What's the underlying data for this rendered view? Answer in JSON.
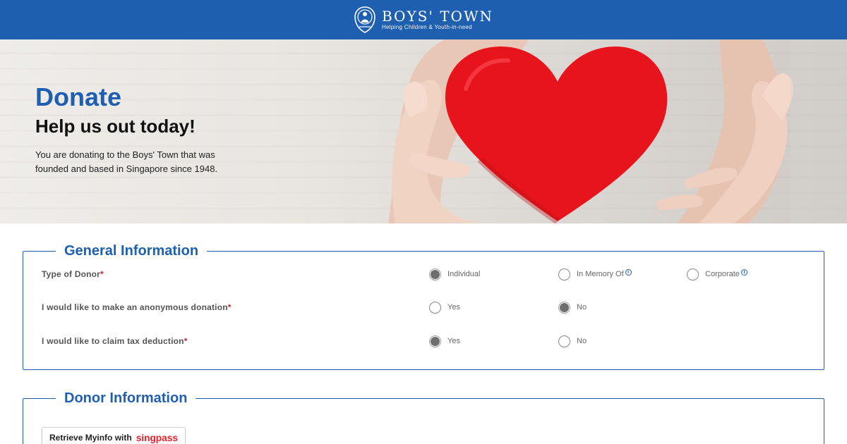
{
  "header": {
    "brand_name": "BOYS' TOWN",
    "brand_tagline": "Helping Children & Youth-in-need",
    "bg_color": "#1f5fb0"
  },
  "hero": {
    "title": "Donate",
    "subtitle": "Help us out today!",
    "description": "You are donating to the Boys' Town that was founded and based in Singapore since 1948.",
    "image_subject": "hands-holding-red-knitted-heart"
  },
  "general_information": {
    "legend": "General Information",
    "questions": [
      {
        "label": "Type of Donor",
        "required_mark": "*",
        "options": [
          {
            "label": "Individual",
            "checked": true,
            "info_icon": false
          },
          {
            "label": "In Memory Of",
            "checked": false,
            "info_icon": true
          },
          {
            "label": "Corporate",
            "checked": false,
            "info_icon": true
          }
        ]
      },
      {
        "label": "I would like to make an anonymous donation",
        "required_mark": "*",
        "options": [
          {
            "label": "Yes",
            "checked": false
          },
          {
            "label": "No",
            "checked": true
          }
        ]
      },
      {
        "label": "I would like to claim tax deduction",
        "required_mark": "*",
        "options": [
          {
            "label": "Yes",
            "checked": true
          },
          {
            "label": "No",
            "checked": false
          }
        ]
      }
    ]
  },
  "donor_information": {
    "legend": "Donor Information",
    "myinfo_button": {
      "label": "Retrieve Myinfo with",
      "brand": "singpass"
    }
  },
  "colors": {
    "accent": "#1f5fb0",
    "required": "#c0272d",
    "singpass": "#e0262f",
    "heart": "#e8141c"
  }
}
